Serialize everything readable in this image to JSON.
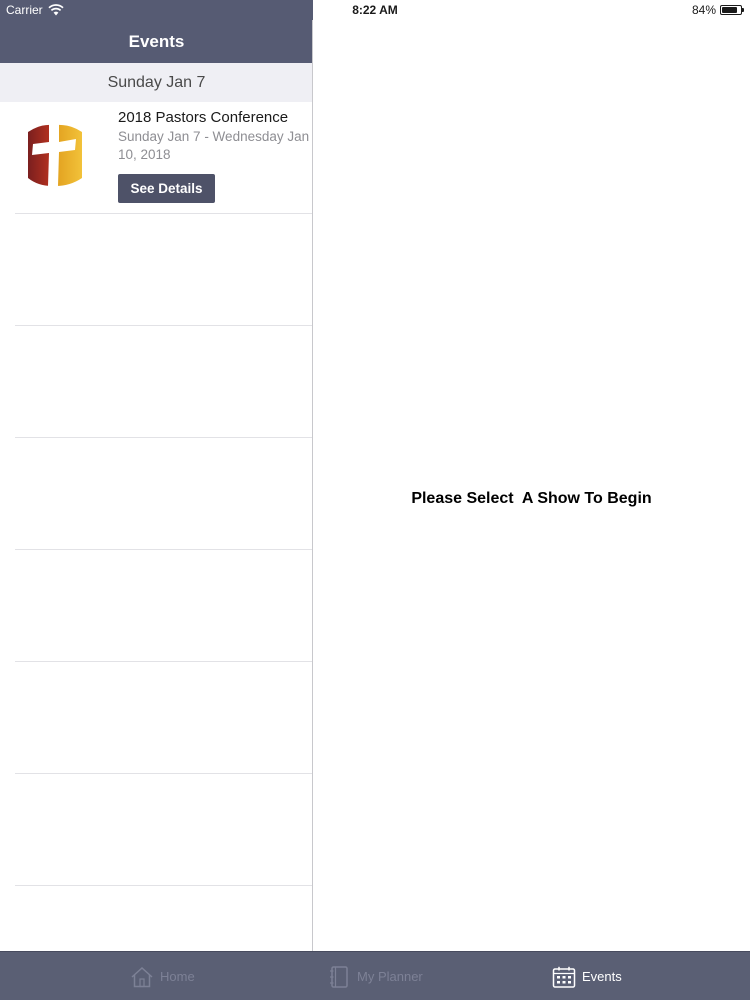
{
  "status_bar": {
    "carrier": "Carrier",
    "time": "8:22 AM",
    "battery": "84%",
    "battery_level": 0.84
  },
  "master": {
    "title": "Events",
    "section": "Sunday Jan 7",
    "events": [
      {
        "title": "2018 Pastors Conference",
        "dates": "Sunday Jan 7 - Wednesday Jan 10, 2018",
        "button": "See Details",
        "logo_icon": "cross-logo-icon"
      }
    ]
  },
  "detail": {
    "message": "Please Select  A Show To Begin"
  },
  "tab_bar": {
    "tabs": [
      {
        "label": "Home",
        "icon": "home-icon",
        "active": false
      },
      {
        "label": "My Planner",
        "icon": "planner-icon",
        "active": false
      },
      {
        "label": "Events",
        "icon": "calendar-icon",
        "active": true
      }
    ]
  },
  "colors": {
    "nav_background": "#565b73",
    "tab_bar_background": "#5a5f74",
    "button_background": "#4e5268",
    "section_background": "#efeff4"
  }
}
